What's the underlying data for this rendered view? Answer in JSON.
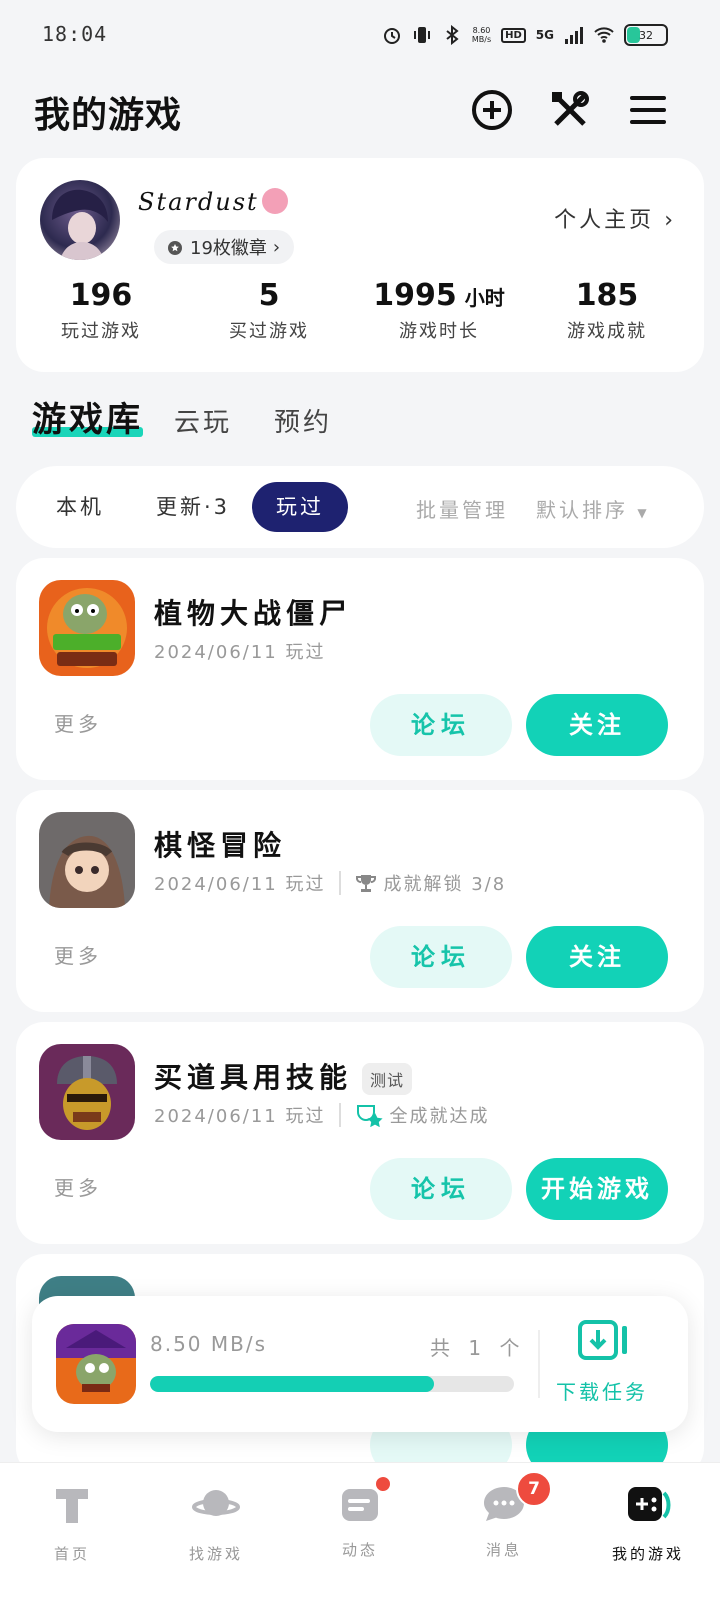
{
  "status_bar": {
    "time": "18:04",
    "net_speed_top": "8.60",
    "net_speed_unit": "MB/s",
    "network": "5G",
    "hd": "HD",
    "battery": "32"
  },
  "header": {
    "title": "我的游戏"
  },
  "profile": {
    "username": "Stardust",
    "medals": "19枚徽章",
    "homepage_link": "个人主页",
    "stats": [
      {
        "value": "196",
        "unit": "",
        "label": "玩过游戏"
      },
      {
        "value": "5",
        "unit": "",
        "label": "买过游戏"
      },
      {
        "value": "1995",
        "unit": "小时",
        "label": "游戏时长"
      },
      {
        "value": "185",
        "unit": "",
        "label": "游戏成就"
      }
    ]
  },
  "tabs": [
    "游戏库",
    "云玩",
    "预约"
  ],
  "filters": {
    "chips": [
      "本机",
      "更新·3",
      "玩过"
    ],
    "batch": "批量管理",
    "sort": "默认排序"
  },
  "games": [
    {
      "name": "植物大战僵尸",
      "tag": "",
      "date": "2024/06/11 玩过",
      "achievement": "",
      "more": "更多",
      "forum": "论坛",
      "action": "关注"
    },
    {
      "name": "棋怪冒险",
      "tag": "",
      "date": "2024/06/11 玩过",
      "achievement": "成就解锁 3/8",
      "more": "更多",
      "forum": "论坛",
      "action": "关注"
    },
    {
      "name": "买道具用技能",
      "tag": "测试",
      "date": "2024/06/11 玩过",
      "achievement": "全成就达成",
      "more": "更多",
      "forum": "论坛",
      "action": "开始游戏"
    }
  ],
  "download": {
    "speed": "8.50 MB/s",
    "count": "共 1 个",
    "progress": 0.78,
    "task_label": "下载任务"
  },
  "nav": [
    {
      "label": "首页",
      "badge": ""
    },
    {
      "label": "找游戏",
      "badge": ""
    },
    {
      "label": "动态",
      "badge": ""
    },
    {
      "label": "消息",
      "badge": "7"
    },
    {
      "label": "我的游戏",
      "badge": ""
    }
  ],
  "colors": {
    "accent": "#12d2b7",
    "chip_active": "#1e2270",
    "badge_red": "#ee4b3e"
  }
}
